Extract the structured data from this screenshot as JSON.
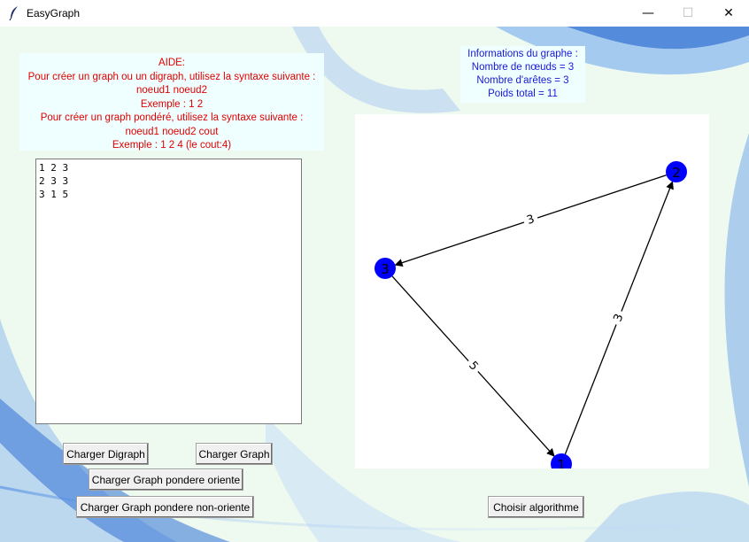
{
  "window": {
    "title": "EasyGraph",
    "controls": {
      "minimize": "—",
      "maximize": "☐",
      "close": "✕"
    },
    "icon": "feather-icon"
  },
  "help": {
    "lines": [
      "AIDE:",
      "Pour créer un graph ou un digraph, utilisez la syntaxe suivante :",
      "noeud1 noeud2",
      "Exemple : 1 2",
      "Pour créer un graph pondéré, utilisez la syntaxe suivante :",
      "noeud1 noeud2 cout",
      "Exemple : 1 2 4 (le cout:4)"
    ],
    "color": "#e00000"
  },
  "info": {
    "lines": [
      "Informations du graphe :",
      "Nombre de nœuds = 3",
      "Nombre d'arêtes = 3",
      "Poids total = 11"
    ],
    "color": "#1818d8"
  },
  "editor": {
    "lines": [
      "1 2 3",
      "2 3 3",
      "3 1 5"
    ]
  },
  "graph": {
    "node_color": "#0000ff",
    "nodes": [
      {
        "id": "1",
        "label": "1"
      },
      {
        "id": "2",
        "label": "2"
      },
      {
        "id": "3",
        "label": "3"
      }
    ],
    "edges": [
      {
        "from": "1",
        "to": "2",
        "weight": "3"
      },
      {
        "from": "2",
        "to": "3",
        "weight": "3"
      },
      {
        "from": "3",
        "to": "1",
        "weight": "5"
      }
    ]
  },
  "buttons": {
    "load_digraph": "Charger Digraph",
    "load_graph": "Charger Graph",
    "load_weighted_directed": "Charger Graph pondere oriente",
    "load_weighted_undirected": "Charger Graph pondere non-oriente",
    "choose_algorithm": "Choisir algorithme"
  }
}
